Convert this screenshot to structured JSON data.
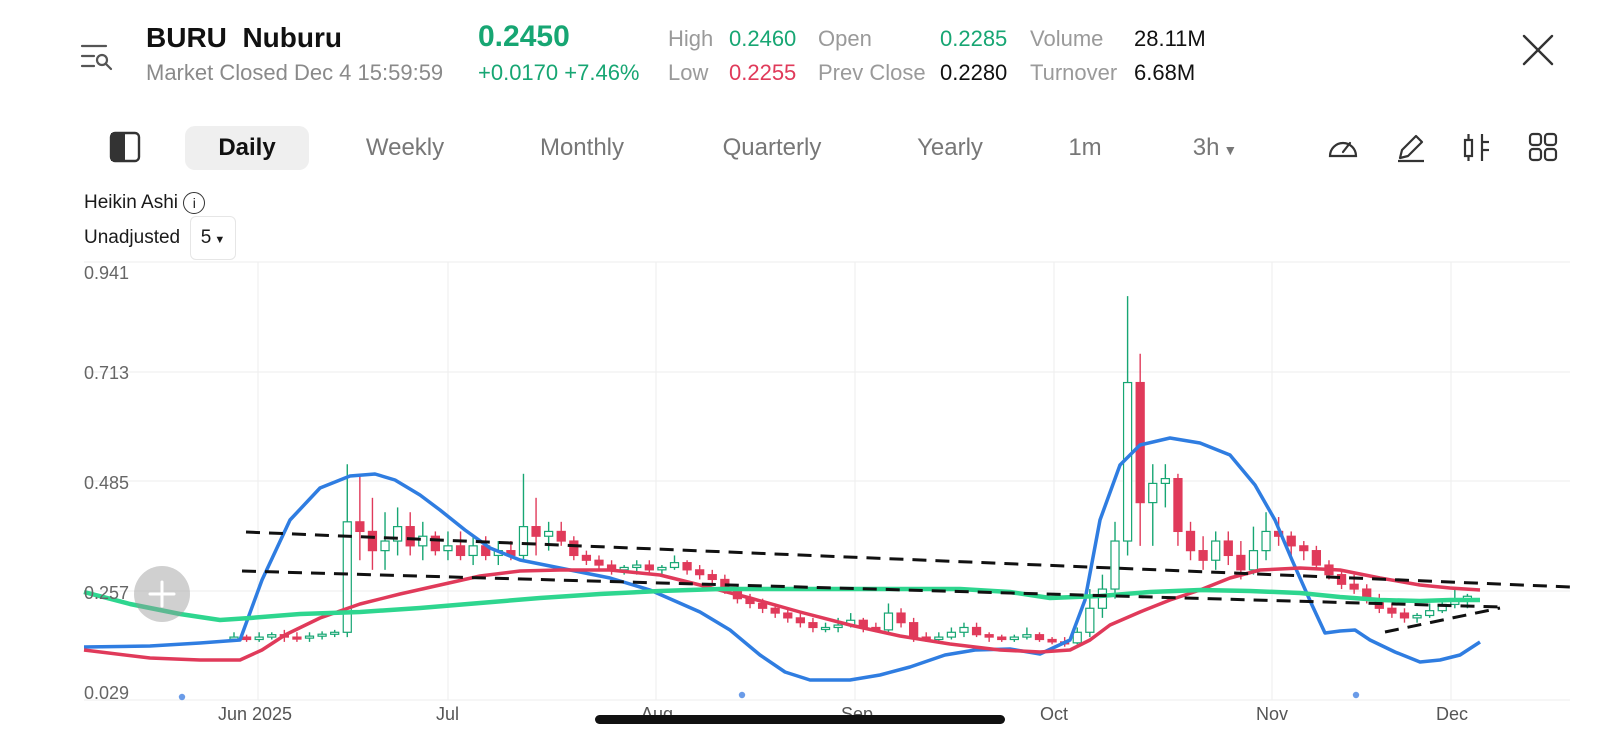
{
  "header": {
    "symbol": "BURU",
    "name": "Nuburu",
    "status": "Market Closed Dec 4 15:59:59",
    "price": "0.2450",
    "change": "+0.0170",
    "change_pct": "+7.46%",
    "stats": {
      "high_label": "High",
      "high": "0.2460",
      "low_label": "Low",
      "low": "0.2255",
      "open_label": "Open",
      "open": "0.2285",
      "prev_close_label": "Prev Close",
      "prev_close": "0.2280",
      "volume_label": "Volume",
      "volume": "28.11M",
      "turnover_label": "Turnover",
      "turnover": "6.68M"
    }
  },
  "tabs": [
    {
      "label": "Daily",
      "active": true
    },
    {
      "label": "Weekly"
    },
    {
      "label": "Monthly"
    },
    {
      "label": "Quarterly"
    },
    {
      "label": "Yearly"
    },
    {
      "label": "1m"
    },
    {
      "label": "3h"
    }
  ],
  "toolbar_icons": [
    "gauge-icon",
    "pen-icon",
    "indicator-icon",
    "grid-icon"
  ],
  "chart_settings": {
    "chart_style": "Heikin Ashi",
    "adjustment": "Unadjusted",
    "selector_value": "5"
  },
  "colors": {
    "up": "#17a673",
    "down": "#e03a5a",
    "line_blue": "#2f7de1",
    "line_red": "#e03a5a",
    "line_green": "#2ed68f"
  },
  "chart_data": {
    "type": "candlestick",
    "y_ticks": [
      "0.941",
      "0.713",
      "0.485",
      "0.257",
      "0.029"
    ],
    "x_ticks": [
      "Jun 2025",
      "Jul",
      "Aug",
      "Sep",
      "Oct",
      "Nov",
      "Dec"
    ],
    "ylim": [
      0.029,
      0.941
    ],
    "grid": true,
    "series": [
      {
        "kind": "candles",
        "values": [
          [
            0.16,
            0.17,
            0.15,
            0.16
          ],
          [
            0.16,
            0.165,
            0.15,
            0.155
          ],
          [
            0.155,
            0.17,
            0.15,
            0.16
          ],
          [
            0.16,
            0.17,
            0.155,
            0.165
          ],
          [
            0.165,
            0.175,
            0.15,
            0.16
          ],
          [
            0.16,
            0.17,
            0.15,
            0.158
          ],
          [
            0.158,
            0.17,
            0.15,
            0.162
          ],
          [
            0.162,
            0.172,
            0.155,
            0.166
          ],
          [
            0.166,
            0.175,
            0.16,
            0.17
          ],
          [
            0.17,
            0.52,
            0.16,
            0.4
          ],
          [
            0.4,
            0.5,
            0.32,
            0.38
          ],
          [
            0.38,
            0.45,
            0.3,
            0.34
          ],
          [
            0.34,
            0.42,
            0.3,
            0.36
          ],
          [
            0.36,
            0.43,
            0.33,
            0.39
          ],
          [
            0.39,
            0.42,
            0.33,
            0.35
          ],
          [
            0.35,
            0.4,
            0.32,
            0.37
          ],
          [
            0.37,
            0.38,
            0.33,
            0.34
          ],
          [
            0.34,
            0.38,
            0.32,
            0.35
          ],
          [
            0.35,
            0.38,
            0.32,
            0.33
          ],
          [
            0.33,
            0.37,
            0.31,
            0.35
          ],
          [
            0.35,
            0.37,
            0.32,
            0.33
          ],
          [
            0.33,
            0.36,
            0.31,
            0.34
          ],
          [
            0.34,
            0.36,
            0.32,
            0.33
          ],
          [
            0.33,
            0.5,
            0.32,
            0.39
          ],
          [
            0.39,
            0.45,
            0.33,
            0.37
          ],
          [
            0.37,
            0.4,
            0.34,
            0.38
          ],
          [
            0.38,
            0.4,
            0.35,
            0.36
          ],
          [
            0.36,
            0.37,
            0.32,
            0.33
          ],
          [
            0.33,
            0.34,
            0.31,
            0.32
          ],
          [
            0.32,
            0.33,
            0.3,
            0.31
          ],
          [
            0.31,
            0.32,
            0.29,
            0.3
          ],
          [
            0.3,
            0.31,
            0.29,
            0.305
          ],
          [
            0.305,
            0.32,
            0.29,
            0.31
          ],
          [
            0.31,
            0.32,
            0.29,
            0.3
          ],
          [
            0.3,
            0.31,
            0.29,
            0.305
          ],
          [
            0.305,
            0.33,
            0.3,
            0.315
          ],
          [
            0.315,
            0.32,
            0.29,
            0.3
          ],
          [
            0.3,
            0.31,
            0.28,
            0.29
          ],
          [
            0.29,
            0.3,
            0.27,
            0.28
          ],
          [
            0.28,
            0.29,
            0.25,
            0.26
          ],
          [
            0.26,
            0.27,
            0.23,
            0.24
          ],
          [
            0.24,
            0.25,
            0.22,
            0.23
          ],
          [
            0.23,
            0.24,
            0.21,
            0.22
          ],
          [
            0.22,
            0.23,
            0.2,
            0.21
          ],
          [
            0.21,
            0.22,
            0.19,
            0.2
          ],
          [
            0.2,
            0.21,
            0.18,
            0.19
          ],
          [
            0.19,
            0.2,
            0.17,
            0.18
          ],
          [
            0.18,
            0.19,
            0.17,
            0.18
          ],
          [
            0.18,
            0.2,
            0.17,
            0.185
          ],
          [
            0.185,
            0.21,
            0.18,
            0.195
          ],
          [
            0.195,
            0.2,
            0.17,
            0.18
          ],
          [
            0.18,
            0.19,
            0.17,
            0.175
          ],
          [
            0.175,
            0.23,
            0.17,
            0.21
          ],
          [
            0.21,
            0.22,
            0.18,
            0.19
          ],
          [
            0.19,
            0.2,
            0.15,
            0.16
          ],
          [
            0.16,
            0.17,
            0.15,
            0.155
          ],
          [
            0.155,
            0.17,
            0.15,
            0.16
          ],
          [
            0.16,
            0.18,
            0.155,
            0.17
          ],
          [
            0.17,
            0.19,
            0.16,
            0.18
          ],
          [
            0.18,
            0.19,
            0.16,
            0.165
          ],
          [
            0.165,
            0.17,
            0.15,
            0.16
          ],
          [
            0.16,
            0.165,
            0.15,
            0.155
          ],
          [
            0.155,
            0.165,
            0.15,
            0.16
          ],
          [
            0.16,
            0.18,
            0.155,
            0.165
          ],
          [
            0.165,
            0.17,
            0.15,
            0.155
          ],
          [
            0.155,
            0.16,
            0.145,
            0.15
          ],
          [
            0.15,
            0.16,
            0.14,
            0.148
          ],
          [
            0.148,
            0.18,
            0.145,
            0.17
          ],
          [
            0.17,
            0.26,
            0.16,
            0.22
          ],
          [
            0.22,
            0.29,
            0.2,
            0.26
          ],
          [
            0.26,
            0.4,
            0.24,
            0.36
          ],
          [
            0.36,
            0.87,
            0.33,
            0.69
          ],
          [
            0.69,
            0.75,
            0.35,
            0.44
          ],
          [
            0.44,
            0.52,
            0.35,
            0.48
          ],
          [
            0.48,
            0.52,
            0.43,
            0.49
          ],
          [
            0.49,
            0.5,
            0.35,
            0.38
          ],
          [
            0.38,
            0.4,
            0.32,
            0.34
          ],
          [
            0.34,
            0.37,
            0.3,
            0.32
          ],
          [
            0.32,
            0.38,
            0.3,
            0.36
          ],
          [
            0.36,
            0.38,
            0.31,
            0.33
          ],
          [
            0.33,
            0.36,
            0.28,
            0.3
          ],
          [
            0.3,
            0.39,
            0.29,
            0.34
          ],
          [
            0.34,
            0.42,
            0.32,
            0.38
          ],
          [
            0.38,
            0.41,
            0.35,
            0.37
          ],
          [
            0.37,
            0.38,
            0.33,
            0.35
          ],
          [
            0.35,
            0.36,
            0.32,
            0.34
          ],
          [
            0.34,
            0.35,
            0.3,
            0.31
          ],
          [
            0.31,
            0.32,
            0.28,
            0.29
          ],
          [
            0.29,
            0.3,
            0.26,
            0.27
          ],
          [
            0.27,
            0.29,
            0.25,
            0.26
          ],
          [
            0.26,
            0.27,
            0.23,
            0.24
          ],
          [
            0.24,
            0.25,
            0.21,
            0.22
          ],
          [
            0.22,
            0.23,
            0.2,
            0.21
          ],
          [
            0.21,
            0.22,
            0.19,
            0.2
          ],
          [
            0.2,
            0.21,
            0.19,
            0.205
          ],
          [
            0.205,
            0.23,
            0.2,
            0.215
          ],
          [
            0.215,
            0.24,
            0.21,
            0.228
          ],
          [
            0.228,
            0.26,
            0.22,
            0.24
          ],
          [
            0.24,
            0.25,
            0.22,
            0.245
          ]
        ]
      },
      {
        "kind": "line",
        "color": "line_blue",
        "values": [
          0.15,
          0.15,
          0.15,
          0.152,
          0.155,
          0.158,
          0.16,
          0.162,
          0.165,
          0.25,
          0.35,
          0.42,
          0.46,
          0.48,
          0.5,
          0.5,
          0.49,
          0.47,
          0.45,
          0.44,
          0.42,
          0.4,
          0.39,
          0.37,
          0.35,
          0.33,
          0.31,
          0.29,
          0.28,
          0.27,
          0.26,
          0.25,
          0.24,
          0.22,
          0.21,
          0.19,
          0.17,
          0.15,
          0.13,
          0.11,
          0.095,
          0.085,
          0.08,
          0.08,
          0.085,
          0.09,
          0.1,
          0.11,
          0.12,
          0.12,
          0.125,
          0.125,
          0.12,
          0.11,
          0.12,
          0.18,
          0.32,
          0.46,
          0.52,
          0.55,
          0.56,
          0.56,
          0.55,
          0.55,
          0.54,
          0.52,
          0.48,
          0.42,
          0.33,
          0.22,
          0.19,
          0.18,
          0.16,
          0.14,
          0.12,
          0.12,
          0.13,
          0.15
        ]
      },
      {
        "kind": "line",
        "color": "line_red",
        "values": [
          0.12,
          0.115,
          0.11,
          0.11,
          0.11,
          0.11,
          0.11,
          0.11,
          0.115,
          0.14,
          0.17,
          0.19,
          0.205,
          0.22,
          0.235,
          0.245,
          0.255,
          0.265,
          0.275,
          0.285,
          0.29,
          0.295,
          0.295,
          0.29,
          0.285,
          0.275,
          0.265,
          0.255,
          0.245,
          0.235,
          0.225,
          0.215,
          0.205,
          0.195,
          0.185,
          0.175,
          0.165,
          0.16,
          0.155,
          0.155,
          0.16,
          0.17,
          0.19,
          0.23,
          0.26,
          0.28,
          0.29,
          0.295,
          0.3,
          0.3,
          0.298,
          0.295,
          0.29,
          0.28,
          0.27,
          0.265
        ]
      },
      {
        "kind": "line",
        "color": "line_green",
        "values": [
          0.26,
          0.24,
          0.23,
          0.22,
          0.21,
          0.205,
          0.21,
          0.215,
          0.22,
          0.225,
          0.23,
          0.235,
          0.245,
          0.25,
          0.255,
          0.26,
          0.265,
          0.265,
          0.265,
          0.265,
          0.265,
          0.265,
          0.265,
          0.262,
          0.262,
          0.26,
          0.258,
          0.255,
          0.255,
          0.255,
          0.255,
          0.255,
          0.255,
          0.255,
          0.252,
          0.25,
          0.245,
          0.245
        ]
      }
    ],
    "trendlines": "dashed black"
  }
}
